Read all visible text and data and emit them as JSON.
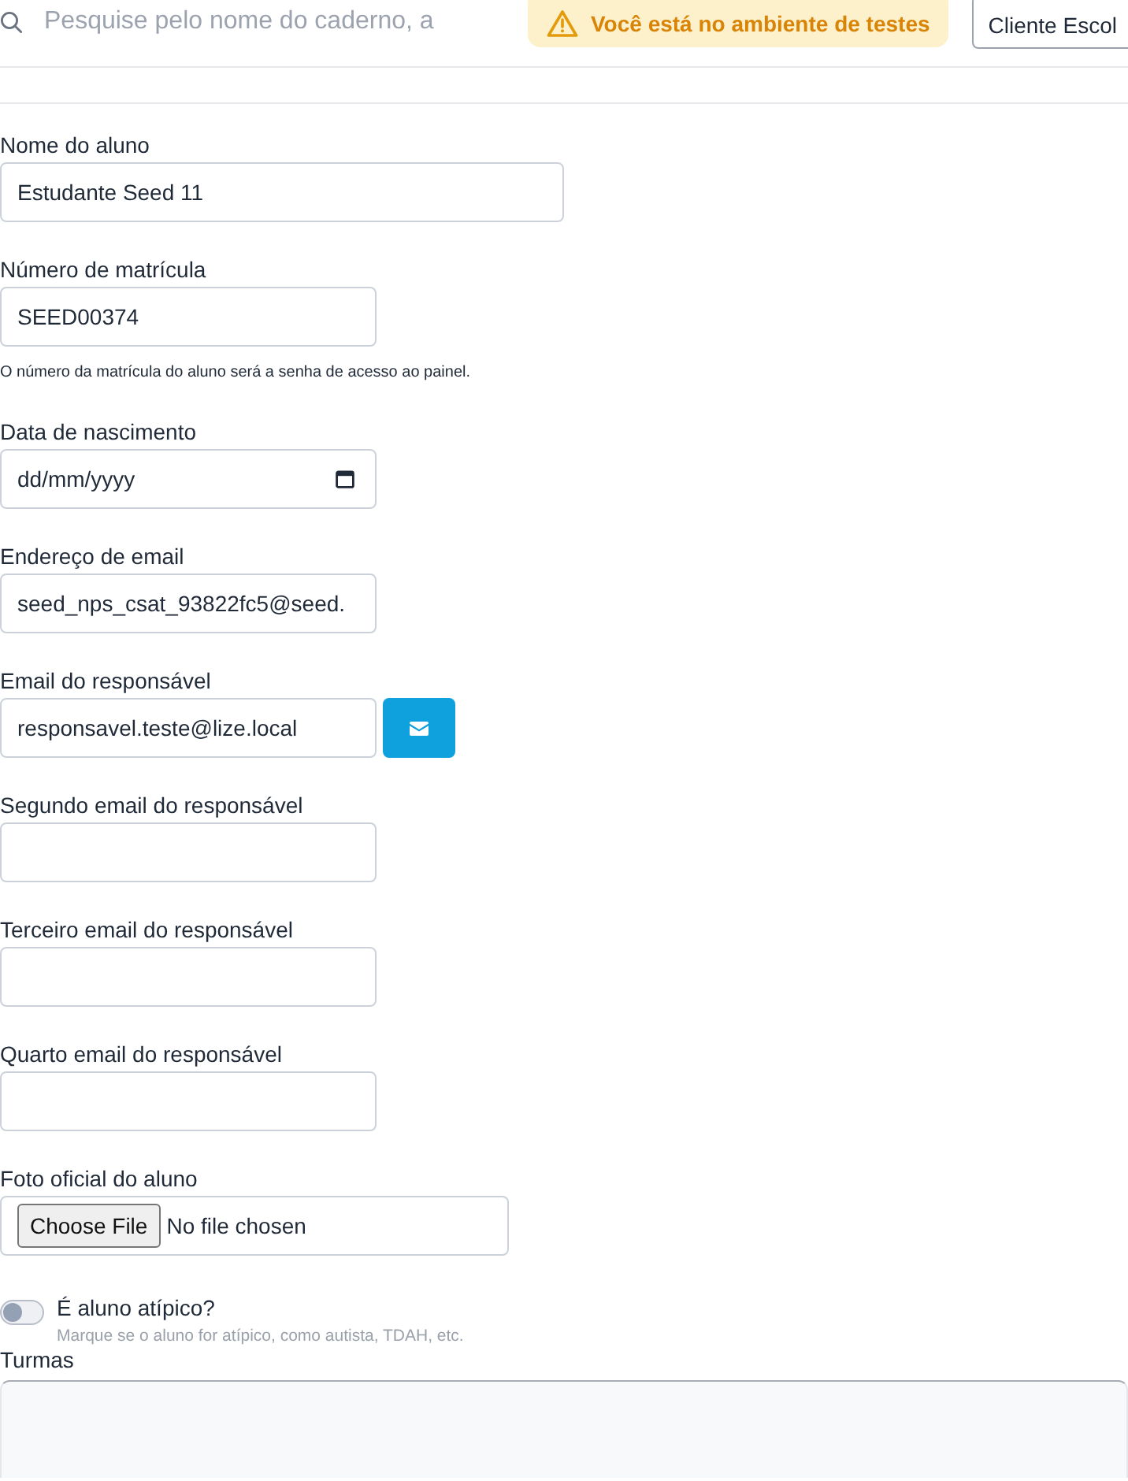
{
  "header": {
    "search": {
      "placeholder": "Pesquise pelo nome do caderno, a"
    },
    "environment_notice": "Você está no ambiente de testes",
    "client_select": {
      "value": "Cliente Escol"
    }
  },
  "fields": [
    {
      "kind": "text",
      "label": "Nome do aluno",
      "value": "Estudante Seed 11"
    },
    {
      "kind": "text",
      "label": "Número de matrícula",
      "value": "SEED00374",
      "hint": "O número da matrícula do aluno será a senha de acesso ao painel."
    },
    {
      "kind": "date",
      "label": "Data de nascimento",
      "value": "dd/mm/yyyy"
    },
    {
      "kind": "text",
      "label": "Endereço de email",
      "value": "seed_nps_csat_93822fc5@seed."
    },
    {
      "kind": "text_with_button",
      "label": "Email do responsável",
      "value": "responsavel.teste@lize.local"
    },
    {
      "kind": "text",
      "label": "Segundo email do responsável"
    },
    {
      "kind": "text",
      "label": "Terceiro email do responsável"
    },
    {
      "kind": "text",
      "label": "Quarto email do responsável"
    },
    {
      "kind": "file",
      "label": "Foto oficial do aluno",
      "button_label": "Choose File",
      "status": "No file chosen"
    },
    {
      "kind": "toggle",
      "label": "É aluno atípico?",
      "hint": "Marque se o aluno for atípico, como autista, TDAH, etc.",
      "on": false
    },
    {
      "kind": "multiselect",
      "label": "Turmas"
    }
  ]
}
